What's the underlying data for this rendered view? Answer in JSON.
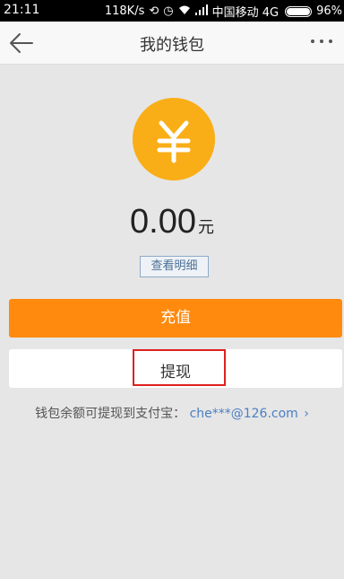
{
  "status_bar": {
    "time": "21:11",
    "speed": "118K/s",
    "carrier": "中国移动 4G",
    "battery": "96%"
  },
  "nav": {
    "title": "我的钱包"
  },
  "wallet": {
    "amount": "0.00",
    "unit": "元",
    "detail_link": "查看明细",
    "recharge_label": "充值",
    "withdraw_label": "提现",
    "info_text": "钱包余额可提现到支付宝：",
    "alipay_account": "che***@126.com"
  },
  "colors": {
    "coin": "#f9ae17",
    "recharge": "#ff8a0e",
    "highlight": "#e02020",
    "link": "#4a7fc2"
  }
}
